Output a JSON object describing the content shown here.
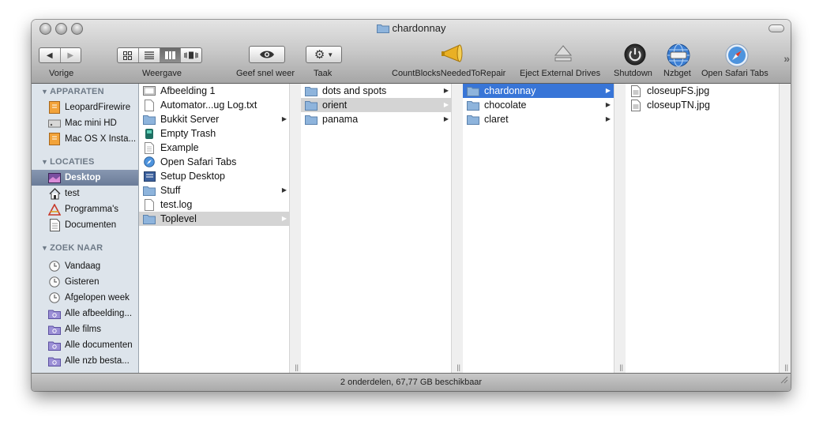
{
  "window": {
    "title": "chardonnay"
  },
  "toolbar": {
    "back_label": "Vorige",
    "view_label": "Weergave",
    "quicklook_label": "Geef snel weer",
    "action_label": "Taak",
    "items": [
      {
        "label": "CountBlocksNeededToRepair",
        "icon": "megaphone-icon"
      },
      {
        "label": "Eject External Drives",
        "icon": "eject-icon"
      },
      {
        "label": "Shutdown",
        "icon": "power-icon"
      },
      {
        "label": "Nzbget",
        "icon": "globe-icon"
      },
      {
        "label": "Open Safari Tabs",
        "icon": "compass-icon"
      }
    ]
  },
  "sidebar": {
    "sections": [
      {
        "heading": "APPARATEN",
        "items": [
          {
            "label": "LeopardFirewire",
            "icon": "drive-orange-icon"
          },
          {
            "label": "Mac mini HD",
            "icon": "harddisk-icon"
          },
          {
            "label": "Mac OS X Insta...",
            "icon": "drive-orange-icon"
          }
        ]
      },
      {
        "heading": "LOCATIES",
        "items": [
          {
            "label": "Desktop",
            "icon": "desktop-icon",
            "selected": true
          },
          {
            "label": "test",
            "icon": "home-icon"
          },
          {
            "label": "Programma's",
            "icon": "applications-icon"
          },
          {
            "label": "Documenten",
            "icon": "document-icon"
          }
        ]
      },
      {
        "heading": "ZOEK NAAR",
        "items": [
          {
            "label": "Vandaag",
            "icon": "clock-icon"
          },
          {
            "label": "Gisteren",
            "icon": "clock-icon"
          },
          {
            "label": "Afgelopen week",
            "icon": "clock-icon"
          },
          {
            "label": "Alle afbeelding...",
            "icon": "smart-folder-icon"
          },
          {
            "label": "Alle films",
            "icon": "smart-folder-icon"
          },
          {
            "label": "Alle documenten",
            "icon": "smart-folder-icon"
          },
          {
            "label": "Alle nzb besta...",
            "icon": "smart-folder-icon"
          }
        ]
      }
    ]
  },
  "columns": [
    {
      "items": [
        {
          "label": "Afbeelding 1",
          "icon": "image-file-icon"
        },
        {
          "label": "Automator...ug Log.txt",
          "icon": "text-file-icon"
        },
        {
          "label": "Bukkit Server",
          "icon": "folder-icon",
          "arrow": true
        },
        {
          "label": "Empty Trash",
          "icon": "app-icon"
        },
        {
          "label": "Example",
          "icon": "text-file-icon"
        },
        {
          "label": "Open Safari Tabs",
          "icon": "compass-icon"
        },
        {
          "label": "Setup Desktop",
          "icon": "app-icon"
        },
        {
          "label": "Stuff",
          "icon": "folder-icon",
          "arrow": true
        },
        {
          "label": "test.log",
          "icon": "text-file-icon"
        },
        {
          "label": "Toplevel",
          "icon": "folder-icon",
          "arrow": true,
          "state": "gray"
        }
      ]
    },
    {
      "items": [
        {
          "label": "dots and spots",
          "icon": "folder-icon",
          "arrow": true
        },
        {
          "label": "orient",
          "icon": "folder-icon",
          "arrow": true,
          "state": "gray"
        },
        {
          "label": "panama",
          "icon": "folder-icon",
          "arrow": true
        }
      ]
    },
    {
      "items": [
        {
          "label": "chardonnay",
          "icon": "folder-icon",
          "arrow": true,
          "state": "blue"
        },
        {
          "label": "chocolate",
          "icon": "folder-icon",
          "arrow": true
        },
        {
          "label": "claret",
          "icon": "folder-icon",
          "arrow": true
        }
      ]
    },
    {
      "items": [
        {
          "label": "closeupFS.jpg",
          "icon": "image-file-icon"
        },
        {
          "label": "closeupTN.jpg",
          "icon": "image-file-icon"
        }
      ]
    }
  ],
  "status": {
    "text": "2 onderdelen, 67,77 GB beschikbaar"
  }
}
